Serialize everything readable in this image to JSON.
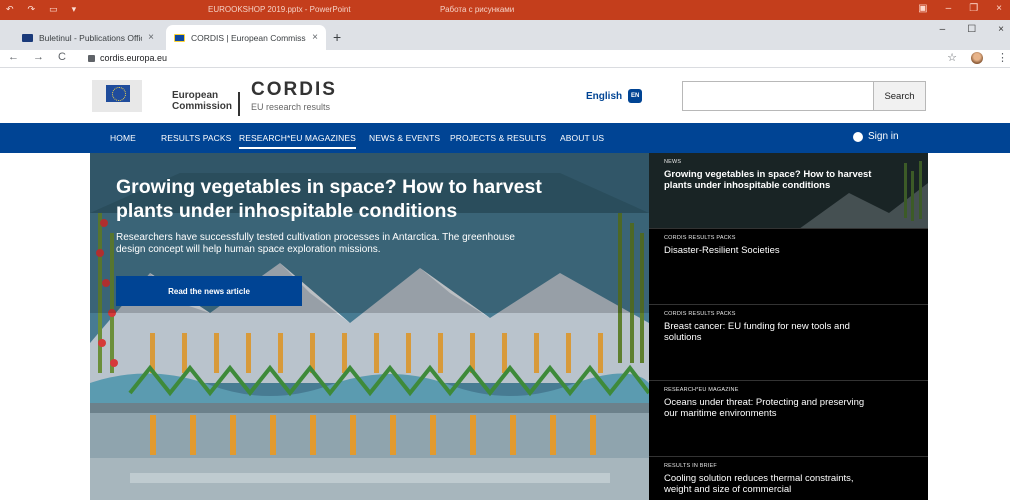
{
  "ppt": {
    "file_title": "EUROOKSHOP 2019.pptx - PowerPoint",
    "subtitle": "Работа с рисунками"
  },
  "tabs": [
    {
      "title": "Buletinul - Publications Office of",
      "close": "×"
    },
    {
      "title": "CORDIS | European Commission",
      "close": "×"
    }
  ],
  "browser": {
    "new_tab": "+",
    "minimize": "–",
    "maximize": "☐",
    "close": "×",
    "back": "←",
    "forward": "→",
    "reload": "C",
    "url": "cordis.europa.eu",
    "star": "☆",
    "menu": "⋮"
  },
  "header": {
    "ec_line1": "European",
    "ec_line2": "Commission",
    "brand": "CORDIS",
    "brand_sub": "EU research results",
    "language": "English",
    "language_code": "EN",
    "search_value": "",
    "search_button": "Search"
  },
  "nav": {
    "items": [
      {
        "label": "HOME"
      },
      {
        "label": "RESULTS PACKS"
      },
      {
        "label": "RESEARCH*EU MAGAZINES"
      },
      {
        "label": "NEWS & EVENTS"
      },
      {
        "label": "PROJECTS & RESULTS"
      },
      {
        "label": "ABOUT US"
      }
    ],
    "active_index": 2,
    "sign_in": "Sign in"
  },
  "hero": {
    "title": "Growing vegetables in space? How to harvest plants under inhospitable conditions",
    "description": "Researchers have successfully tested cultivation processes in Antarctica. The greenhouse design concept will help human space exploration missions.",
    "button": "Read the news article"
  },
  "side_cards": [
    {
      "category": "NEWS",
      "title": "Growing vegetables in space? How to harvest plants under inhospitable conditions"
    },
    {
      "category": "CORDIS RESULTS PACKS",
      "title": "Disaster-Resilient Societies"
    },
    {
      "category": "CORDIS RESULTS PACKS",
      "title": "Breast cancer: EU funding for new tools and solutions"
    },
    {
      "category": "RESEARCH*EU MAGAZINE",
      "title": "Oceans under threat: Protecting and preserving our maritime environments"
    },
    {
      "category": "RESULTS IN BRIEF",
      "title": "Cooling solution reduces thermal constraints, weight and size of commercial"
    }
  ],
  "colors": {
    "eu_blue": "#004494",
    "ppt_orange": "#c43e1c",
    "hero_teal": "#4a7e95"
  }
}
